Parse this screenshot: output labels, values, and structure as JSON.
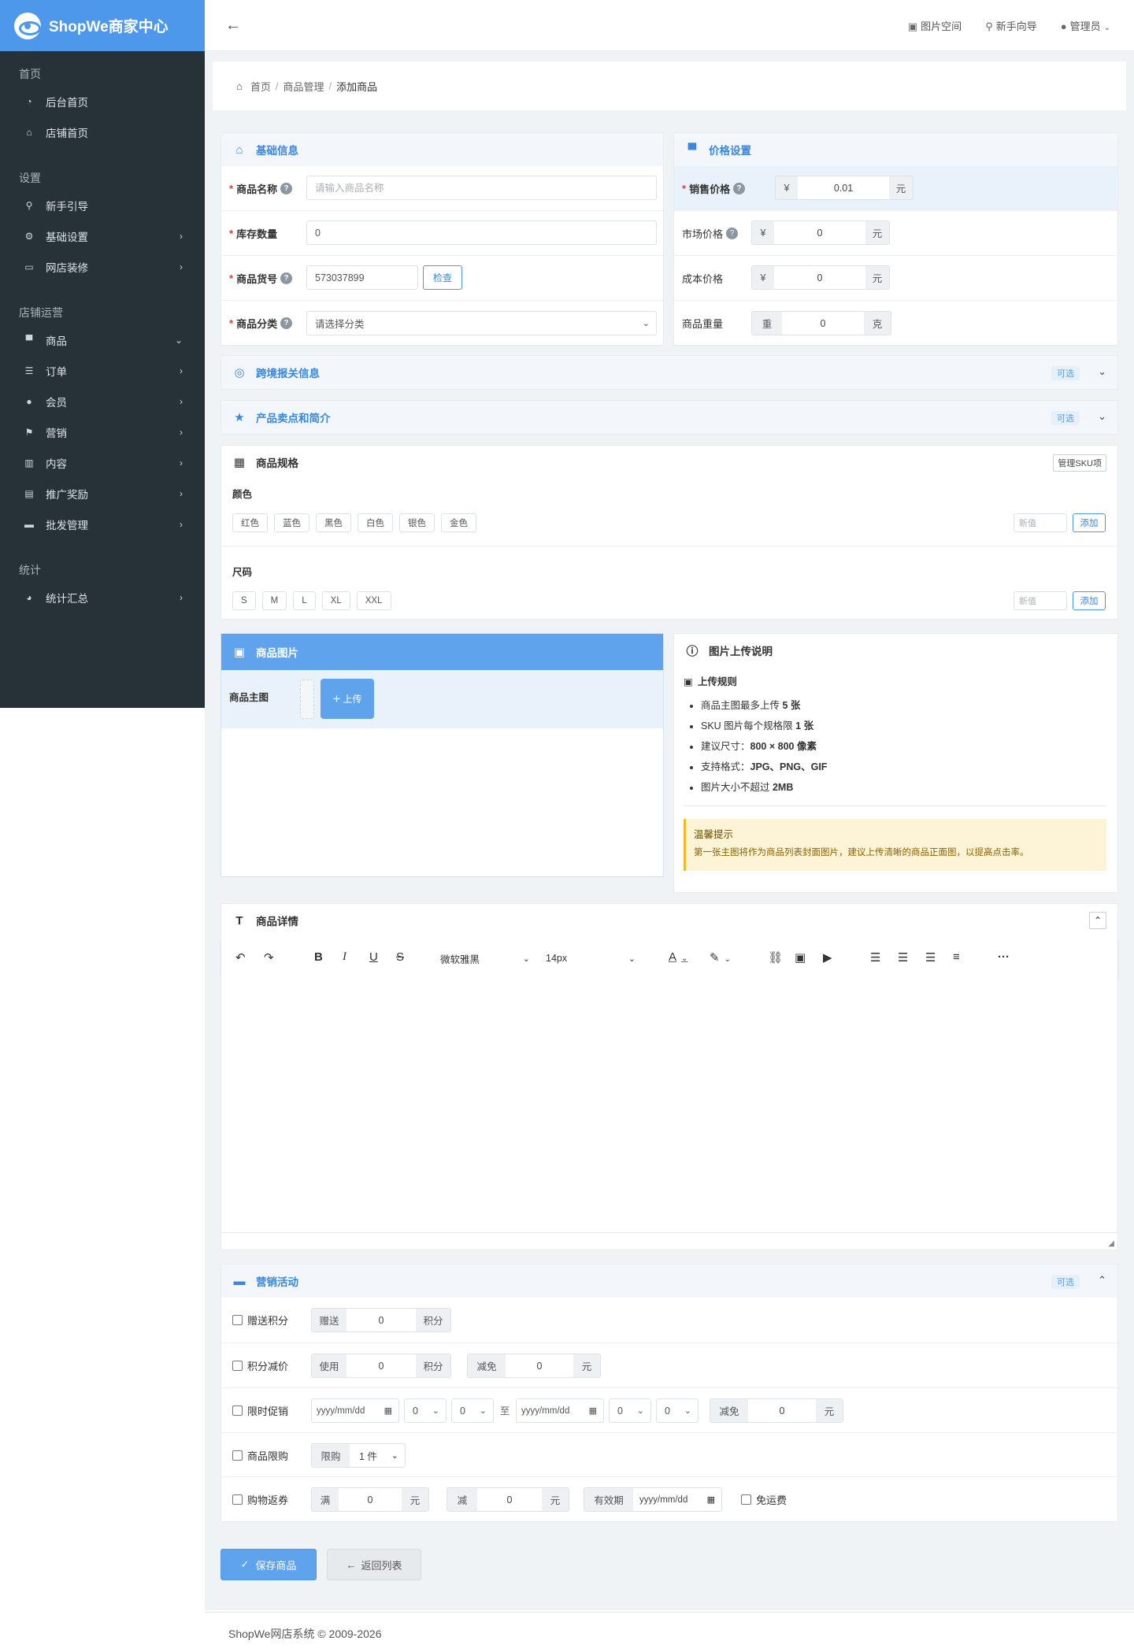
{
  "app": {
    "name": "ShopWe商家中心"
  },
  "sidebar": {
    "groups": [
      {
        "label": "首页",
        "items": [
          {
            "label": "后台首页",
            "icon": "dashboard-icon"
          },
          {
            "label": "店铺首页",
            "icon": "home-icon"
          }
        ]
      },
      {
        "label": "设置",
        "items": [
          {
            "label": "新手引导",
            "icon": "map-marker-icon"
          },
          {
            "label": "基础设置",
            "icon": "gear-icon"
          },
          {
            "label": "网店装修",
            "icon": "monitor-icon"
          }
        ]
      },
      {
        "label": "店铺运营",
        "items": [
          {
            "label": "商品",
            "icon": "cart-icon"
          },
          {
            "label": "订单",
            "icon": "list-icon"
          },
          {
            "label": "会员",
            "icon": "user-icon"
          },
          {
            "label": "营销",
            "icon": "flag-icon"
          },
          {
            "label": "内容",
            "icon": "book-icon"
          },
          {
            "label": "推广奖励",
            "icon": "clipboard-icon"
          },
          {
            "label": "批发管理",
            "icon": "briefcase-icon"
          }
        ]
      },
      {
        "label": "统计",
        "items": [
          {
            "label": "统计汇总",
            "icon": "pie-chart-icon"
          }
        ]
      }
    ]
  },
  "topbar": {
    "links": [
      "图片空间",
      "新手向导",
      "管理员"
    ]
  },
  "breadcrumb": {
    "home": "首页",
    "parent": "商品管理",
    "current": "添加商品"
  },
  "basic": {
    "title": "基础信息",
    "name_label": "商品名称",
    "name_placeholder": "请输入商品名称",
    "stock_label": "库存数量",
    "stock_value": "0",
    "sku_label": "商品货号",
    "sku_value": "573037899",
    "check_btn": "检查",
    "cat_label": "商品分类",
    "cat_placeholder": "请选择分类"
  },
  "price": {
    "title": "价格设置",
    "sale_label": "销售价格",
    "sale_value": "0.01",
    "currency": "¥",
    "unit": "元",
    "market_label": "市场价格",
    "market_value": "0",
    "cost_label": "成本价格",
    "cost_value": "0",
    "weight_label": "商品重量",
    "weight_prefix": "重",
    "weight_value": "0",
    "weight_unit": "克"
  },
  "customs": {
    "title": "跨境报关信息",
    "badge": "可选"
  },
  "selling": {
    "title": "产品卖点和简介",
    "badge": "可选"
  },
  "spec": {
    "title": "商品规格",
    "manage_btn": "管理SKU项",
    "color_label": "颜色",
    "colors": [
      "红色",
      "蓝色",
      "黑色",
      "白色",
      "银色",
      "金色"
    ],
    "size_label": "尺码",
    "sizes": [
      "S",
      "M",
      "L",
      "XL",
      "XXL"
    ],
    "new_placeholder": "新值",
    "add_btn": "添加"
  },
  "images": {
    "title": "商品图片",
    "main_label": "商品主图",
    "upload_btn": "上传"
  },
  "upload_info": {
    "title": "图片上传说明",
    "rules_title": "上传规则",
    "rules": [
      {
        "text": "商品主图最多上传 ",
        "strong": "5 张"
      },
      {
        "text": "SKU 图片每个规格限 ",
        "strong": "1 张"
      },
      {
        "text": "建议尺寸：",
        "strong": "800 × 800 像素"
      },
      {
        "text": "支持格式：",
        "strong": "JPG、PNG、GIF"
      },
      {
        "text": "图片大小不超过 ",
        "strong": "2MB"
      }
    ],
    "tip_title": "温馨提示",
    "tip_text": "第一张主图将作为商品列表封面图片，建议上传清晰的商品正面图，以提高点击率。"
  },
  "detail": {
    "title": "商品详情",
    "font": "微软雅黑",
    "size": "14px"
  },
  "marketing": {
    "title": "营销活动",
    "badge": "可选",
    "points_gift": {
      "label": "赠送积分",
      "prefix": "赠送",
      "value": "0",
      "unit": "积分"
    },
    "points_deduct": {
      "label": "积分减价",
      "prefix": "使用",
      "value": "0",
      "unit": "积分",
      "prefix2": "减免",
      "value2": "0",
      "unit2": "元"
    },
    "flash": {
      "label": "限时促销",
      "date_ph": "yyyy/mm/dd",
      "h": "0",
      "m": "0",
      "to": "至",
      "prefix": "减免",
      "value": "0",
      "unit": "元"
    },
    "limit": {
      "label": "商品限购",
      "prefix": "限购",
      "value": "1 件"
    },
    "coupon": {
      "label": "购物返券",
      "p1": "满",
      "v1": "0",
      "u1": "元",
      "p2": "减",
      "v2": "0",
      "u2": "元",
      "p3": "有效期",
      "date_ph": "yyyy/mm/dd",
      "free": "免运费"
    }
  },
  "actions": {
    "save": "保存商品",
    "back": "返回列表"
  },
  "footer": {
    "text": "ShopWe网店系统 © 2009-2026"
  }
}
